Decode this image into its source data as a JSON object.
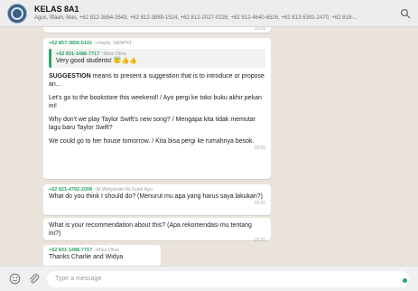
{
  "header": {
    "title": "KELAS 8A1",
    "members": "Agus, Iffaah, Mas, +62 812-3854-3543, +62 812-3889-1524, +62 812-2027-0226, +62 812-4640-6526, +62 813-5391-2470, +62 819-..."
  },
  "messages": {
    "m1": {
      "sender": "+62 857-3856-6101",
      "pushname": "~charle; SENP41"
    },
    "m1_quote": {
      "sender": "+62 831-1488-7717",
      "pushname": "~Miss Olive",
      "text": "Very good students!",
      "emoji": "😇👍👍"
    },
    "m1_suggestion_label": "SUGGESTION",
    "m1_suggestion_text": " means to present a suggestion that is to introduce or propose an...",
    "m1_p1": "Let's go to the bookstore this weekend! / Ayo pergi ke toko buku akhir pekan ini!",
    "m1_p2": "Why don't we play Taylor Swift's new song? / Mengapa kita tidak memutar lagu baru Taylor Swift?",
    "m1_p3": "We could go to her house tomorrow. / Kita bisa pergi ke rumahnya besok.",
    "m1_time": "10:05",
    "m2": {
      "sender": "+62 821-4792-2008",
      "pushname": "~M.Widyantin Ni Gusti Ayu",
      "text": "What do you think I should do? (Menurut mu apa yang harus saya lakukan?)",
      "time": "10:21"
    },
    "m3": {
      "text": "What is your recommendation about this? (Apa rekomendasi mu tentang ini?)",
      "time": "10:21"
    },
    "m4": {
      "sender": "+62 831-1488-7717",
      "pushname": "~Miss Olive",
      "text": "Thanks Charlie and Widya"
    }
  },
  "footer": {
    "placeholder": "Type a message"
  },
  "icons": {
    "search": "search-icon",
    "emoji": "emoji-icon",
    "attach": "paperclip-icon",
    "send": "send-icon"
  },
  "colors": {
    "accent": "#2fa36b",
    "header_bg": "#ededed",
    "chat_bg": "#e9e3dc"
  }
}
